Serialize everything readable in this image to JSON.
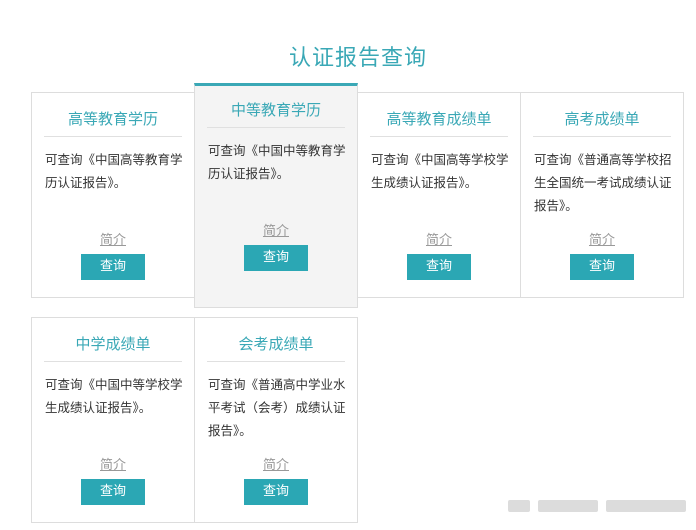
{
  "page": {
    "title": "认证报告查询"
  },
  "cards": [
    {
      "title": "高等教育学历",
      "desc": "可查询《中国高等教育学历认证报告》。",
      "intro": "简介",
      "button": "查询"
    },
    {
      "title": "中等教育学历",
      "desc": "可查询《中国中等教育学历认证报告》。",
      "intro": "简介",
      "button": "查询",
      "active": true
    },
    {
      "title": "高等教育成绩单",
      "desc": "可查询《中国高等学校学生成绩认证报告》。",
      "intro": "简介",
      "button": "查询"
    },
    {
      "title": "高考成绩单",
      "desc": "可查询《普通高等学校招生全国统一考试成绩认证报告》。",
      "intro": "简介",
      "button": "查询"
    },
    {
      "title": "中学成绩单",
      "desc": "可查询《中国中等学校学生成绩认证报告》。",
      "intro": "简介",
      "button": "查询"
    },
    {
      "title": "会考成绩单",
      "desc": "可查询《普通高中学业水平考试（会考）成绩认证报告》。",
      "intro": "简介",
      "button": "查询"
    }
  ],
  "colors": {
    "accent": "#3aa8b6",
    "button": "#2ba7b4",
    "active_bg": "#f4f4f4"
  }
}
